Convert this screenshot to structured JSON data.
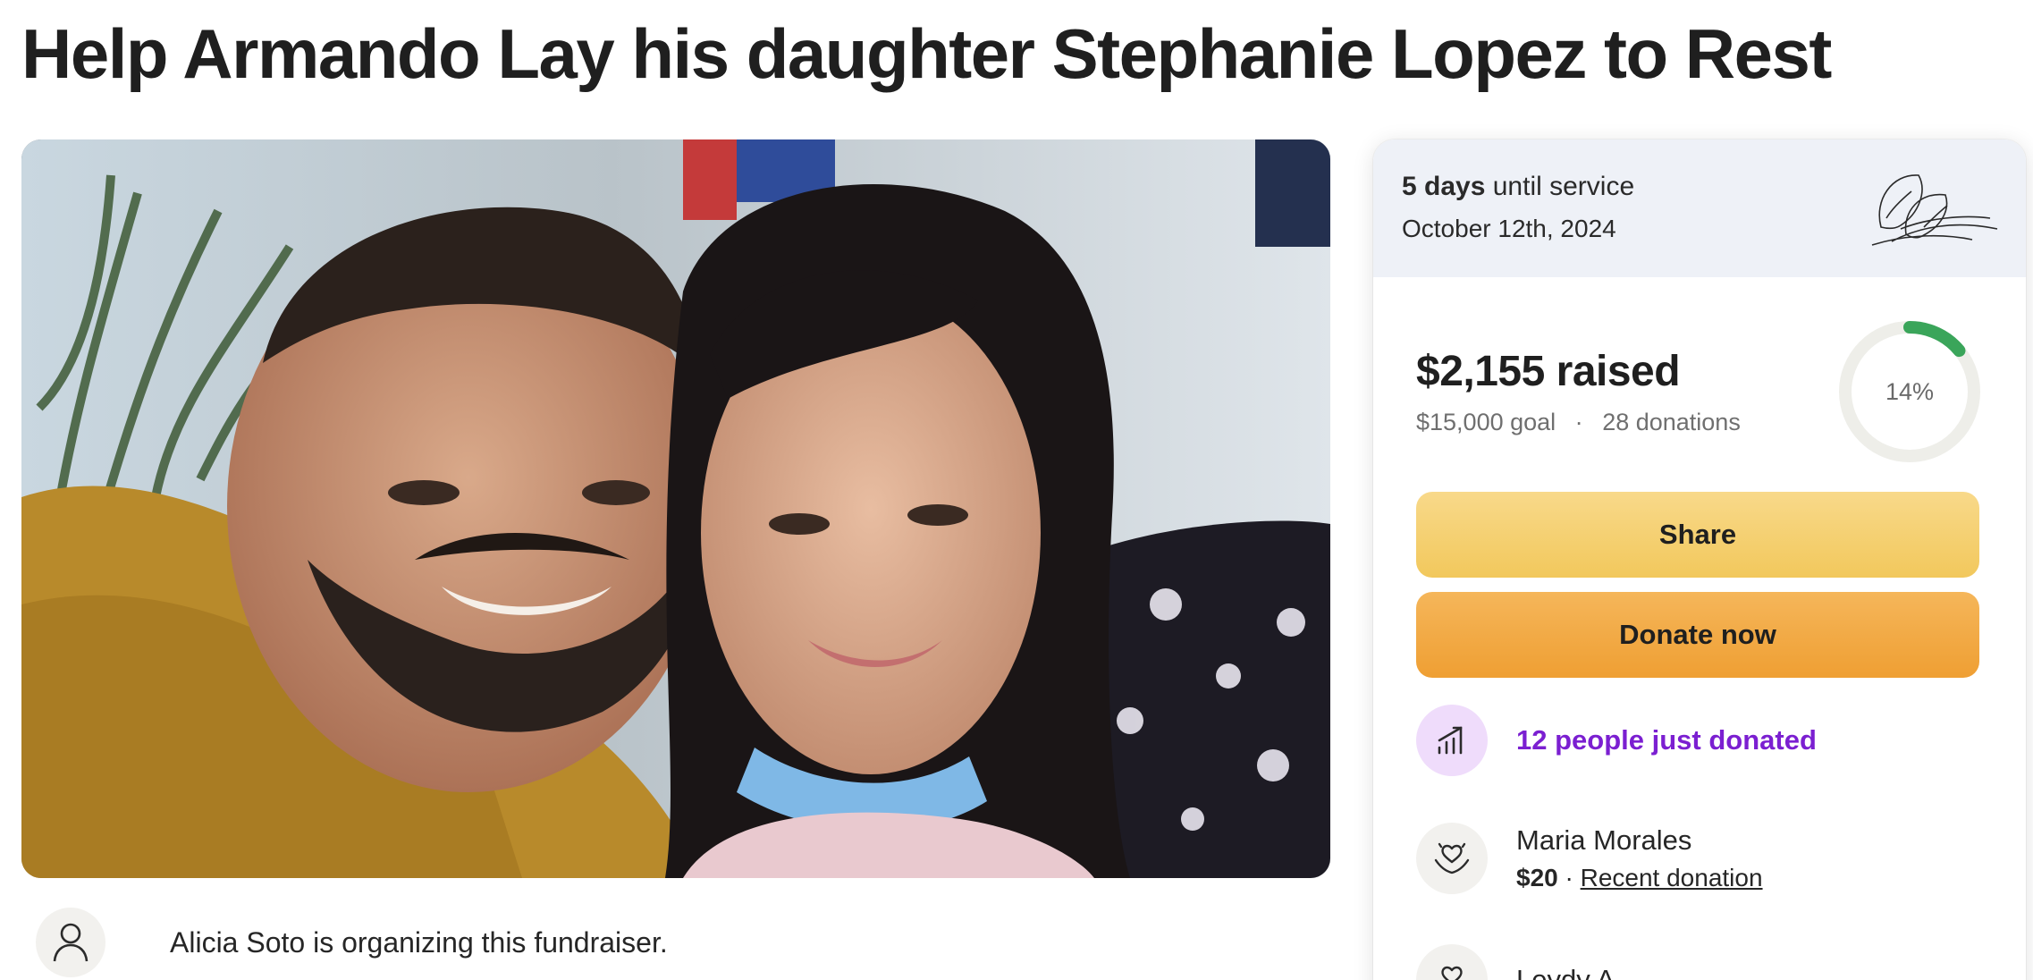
{
  "page": {
    "title": "Help Armando Lay his daughter Stephanie Lopez to Rest"
  },
  "organizer": {
    "text": "Alicia Soto is organizing this fundraiser.",
    "icon": "person-icon"
  },
  "service": {
    "days": "5 days",
    "until": "until service",
    "date": "October 12th, 2024",
    "icon": "calla-lily-icon"
  },
  "progress": {
    "raised": "$2,155 raised",
    "goal": "$15,000 goal",
    "separator": "·",
    "donations": "28 donations",
    "percent_label": "14%",
    "percent_value": 0.14
  },
  "buttons": {
    "share": "Share",
    "donate": "Donate now"
  },
  "activity": {
    "just_donated": "12 people just donated",
    "icon": "trending-up-icon"
  },
  "donations": [
    {
      "name": "Maria Morales",
      "amount": "$20",
      "separator": "·",
      "label": "Recent donation"
    },
    {
      "name": "Leydy A"
    }
  ],
  "colors": {
    "progress_ring": "#3aa55a",
    "ring_track": "#eeeee9",
    "purple_accent": "#7b1fd1",
    "share_button": "#f2c85c",
    "donate_button": "#ef9f33",
    "service_banner": "#eef1f7"
  }
}
